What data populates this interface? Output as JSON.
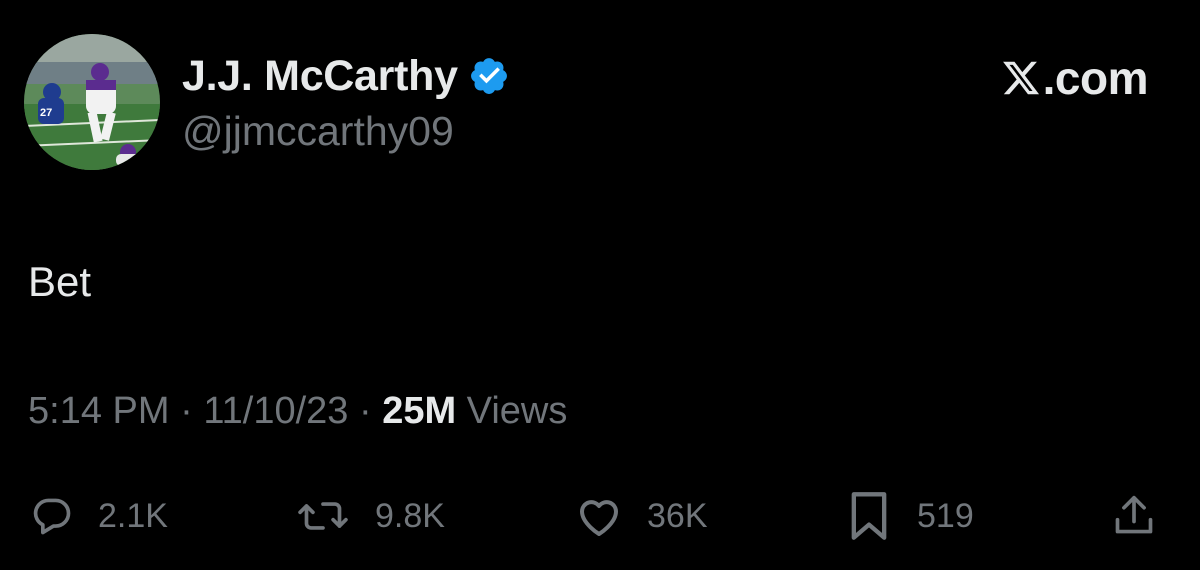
{
  "author": {
    "display_name": "J.J. McCarthy",
    "handle": "@jjmccarthy09",
    "verified": true,
    "avatar_icon": "football-player-avatar"
  },
  "brand": {
    "logo_icon": "x-logo-icon",
    "suffix": ".com"
  },
  "tweet": {
    "text": "Bet"
  },
  "meta": {
    "time": "5:14 PM",
    "separator": " · ",
    "date": "11/10/23",
    "views_count": "25M",
    "views_label": " Views"
  },
  "actions": {
    "reply": {
      "icon": "reply-icon",
      "count": "2.1K"
    },
    "retweet": {
      "icon": "retweet-icon",
      "count": "9.8K"
    },
    "like": {
      "icon": "heart-icon",
      "count": "36K"
    },
    "bookmark": {
      "icon": "bookmark-icon",
      "count": "519"
    },
    "share": {
      "icon": "share-icon"
    }
  },
  "colors": {
    "background": "#000000",
    "primary_text": "#e7e9ea",
    "secondary_text": "#71767b",
    "verified_blue": "#1d9bf0"
  }
}
